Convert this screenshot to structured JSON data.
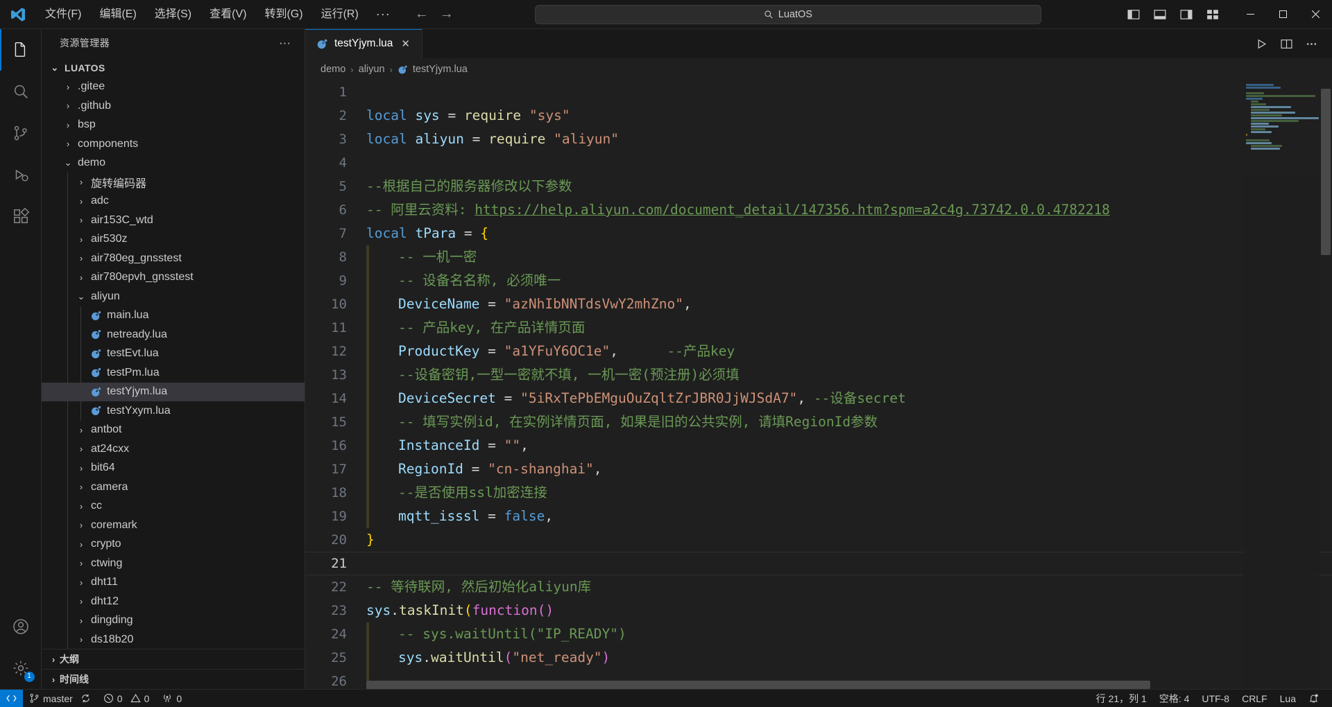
{
  "titlebar": {
    "logo_icon": "vscode-logo",
    "menus": [
      "文件(F)",
      "编辑(E)",
      "选择(S)",
      "查看(V)",
      "转到(G)",
      "运行(R)"
    ],
    "more_label": "···",
    "back_icon": "arrow-left-icon",
    "forward_icon": "arrow-right-icon",
    "search": {
      "value": "LuatOS",
      "icon": "search-icon"
    },
    "layout_icons": [
      "toggle-primary-sidebar-icon",
      "toggle-panel-icon",
      "toggle-secondary-sidebar-icon",
      "customize-layout-icon"
    ],
    "window_buttons": {
      "minimize": "minimize-icon",
      "maximize": "maximize-icon",
      "close": "close-icon"
    }
  },
  "activitybar": {
    "items": [
      {
        "name": "explorer",
        "icon": "files-icon",
        "active": true
      },
      {
        "name": "search",
        "icon": "search-icon",
        "active": false
      },
      {
        "name": "source-control",
        "icon": "source-control-icon",
        "active": false
      },
      {
        "name": "run-and-debug",
        "icon": "debug-icon",
        "active": false
      },
      {
        "name": "extensions",
        "icon": "extensions-icon",
        "active": false
      }
    ],
    "bottom": [
      {
        "name": "accounts",
        "icon": "account-icon",
        "badge": ""
      },
      {
        "name": "settings",
        "icon": "gear-icon",
        "badge": "1"
      }
    ]
  },
  "sidebar": {
    "title": "资源管理器",
    "more_label": "···",
    "root": {
      "label": "LUATOS",
      "expanded": true
    },
    "tree": [
      {
        "label": ".gitee",
        "type": "folder",
        "depth": 1,
        "expanded": false
      },
      {
        "label": ".github",
        "type": "folder",
        "depth": 1,
        "expanded": false
      },
      {
        "label": "bsp",
        "type": "folder",
        "depth": 1,
        "expanded": false
      },
      {
        "label": "components",
        "type": "folder",
        "depth": 1,
        "expanded": false
      },
      {
        "label": "demo",
        "type": "folder",
        "depth": 1,
        "expanded": true
      },
      {
        "label": "旋转编码器",
        "type": "folder",
        "depth": 2,
        "expanded": false
      },
      {
        "label": "adc",
        "type": "folder",
        "depth": 2,
        "expanded": false
      },
      {
        "label": "air153C_wtd",
        "type": "folder",
        "depth": 2,
        "expanded": false
      },
      {
        "label": "air530z",
        "type": "folder",
        "depth": 2,
        "expanded": false
      },
      {
        "label": "air780eg_gnsstest",
        "type": "folder",
        "depth": 2,
        "expanded": false
      },
      {
        "label": "air780epvh_gnsstest",
        "type": "folder",
        "depth": 2,
        "expanded": false
      },
      {
        "label": "aliyun",
        "type": "folder",
        "depth": 2,
        "expanded": true
      },
      {
        "label": "main.lua",
        "type": "lua",
        "depth": 3,
        "expanded": false
      },
      {
        "label": "netready.lua",
        "type": "lua",
        "depth": 3,
        "expanded": false
      },
      {
        "label": "testEvt.lua",
        "type": "lua",
        "depth": 3,
        "expanded": false
      },
      {
        "label": "testPm.lua",
        "type": "lua",
        "depth": 3,
        "expanded": false
      },
      {
        "label": "testYjym.lua",
        "type": "lua",
        "depth": 3,
        "expanded": false,
        "selected": true
      },
      {
        "label": "testYxym.lua",
        "type": "lua",
        "depth": 3,
        "expanded": false
      },
      {
        "label": "antbot",
        "type": "folder",
        "depth": 2,
        "expanded": false
      },
      {
        "label": "at24cxx",
        "type": "folder",
        "depth": 2,
        "expanded": false
      },
      {
        "label": "bit64",
        "type": "folder",
        "depth": 2,
        "expanded": false
      },
      {
        "label": "camera",
        "type": "folder",
        "depth": 2,
        "expanded": false
      },
      {
        "label": "cc",
        "type": "folder",
        "depth": 2,
        "expanded": false
      },
      {
        "label": "coremark",
        "type": "folder",
        "depth": 2,
        "expanded": false
      },
      {
        "label": "crypto",
        "type": "folder",
        "depth": 2,
        "expanded": false
      },
      {
        "label": "ctwing",
        "type": "folder",
        "depth": 2,
        "expanded": false
      },
      {
        "label": "dht11",
        "type": "folder",
        "depth": 2,
        "expanded": false
      },
      {
        "label": "dht12",
        "type": "folder",
        "depth": 2,
        "expanded": false
      },
      {
        "label": "dingding",
        "type": "folder",
        "depth": 2,
        "expanded": false
      },
      {
        "label": "ds18b20",
        "type": "folder",
        "depth": 2,
        "expanded": false
      }
    ],
    "sections": [
      {
        "label": "大纲",
        "expanded": false
      },
      {
        "label": "时间线",
        "expanded": false
      }
    ]
  },
  "editor": {
    "tabs": [
      {
        "label": "testYjym.lua",
        "icon": "lua-file-icon",
        "active": true,
        "close_icon": "close-icon"
      }
    ],
    "actions": [
      "run-icon",
      "split-editor-icon",
      "more-actions-icon"
    ],
    "breadcrumb": [
      "demo",
      "aliyun",
      "testYjym.lua"
    ],
    "breadcrumb_sep": "›",
    "breadcrumb_file_icon": "lua-file-icon",
    "lines": [
      {
        "n": 1,
        "tokens": []
      },
      {
        "n": 2,
        "tokens": [
          {
            "t": "local",
            "c": "k-kw"
          },
          {
            "t": " ",
            "c": "k-plain"
          },
          {
            "t": "sys",
            "c": "k-var"
          },
          {
            "t": " ",
            "c": "k-plain"
          },
          {
            "t": "=",
            "c": "k-op"
          },
          {
            "t": " ",
            "c": "k-plain"
          },
          {
            "t": "require",
            "c": "k-fn"
          },
          {
            "t": " ",
            "c": "k-plain"
          },
          {
            "t": "\"sys\"",
            "c": "k-str"
          }
        ]
      },
      {
        "n": 3,
        "tokens": [
          {
            "t": "local",
            "c": "k-kw"
          },
          {
            "t": " ",
            "c": "k-plain"
          },
          {
            "t": "aliyun",
            "c": "k-var"
          },
          {
            "t": " ",
            "c": "k-plain"
          },
          {
            "t": "=",
            "c": "k-op"
          },
          {
            "t": " ",
            "c": "k-plain"
          },
          {
            "t": "require",
            "c": "k-fn"
          },
          {
            "t": " ",
            "c": "k-plain"
          },
          {
            "t": "\"aliyun\"",
            "c": "k-str"
          }
        ]
      },
      {
        "n": 4,
        "tokens": []
      },
      {
        "n": 5,
        "tokens": [
          {
            "t": "--根据自己的服务器修改以下参数",
            "c": "k-cmt"
          }
        ]
      },
      {
        "n": 6,
        "tokens": [
          {
            "t": "-- 阿里云资料: ",
            "c": "k-cmt"
          },
          {
            "t": "https://help.aliyun.com/document_detail/147356.htm?spm=a2c4g.73742.0.0.4782218",
            "c": "k-link"
          }
        ]
      },
      {
        "n": 7,
        "tokens": [
          {
            "t": "local",
            "c": "k-kw"
          },
          {
            "t": " ",
            "c": "k-plain"
          },
          {
            "t": "tPara",
            "c": "k-var"
          },
          {
            "t": " ",
            "c": "k-plain"
          },
          {
            "t": "=",
            "c": "k-op"
          },
          {
            "t": " ",
            "c": "k-plain"
          },
          {
            "t": "{",
            "c": "k-punc"
          }
        ]
      },
      {
        "n": 8,
        "indent": 1,
        "tokens": [
          {
            "t": "-- 一机一密",
            "c": "k-cmt"
          }
        ]
      },
      {
        "n": 9,
        "indent": 1,
        "tokens": [
          {
            "t": "-- 设备名名称, 必须唯一",
            "c": "k-cmt"
          }
        ]
      },
      {
        "n": 10,
        "indent": 1,
        "tokens": [
          {
            "t": "DeviceName",
            "c": "k-prop"
          },
          {
            "t": " ",
            "c": "k-plain"
          },
          {
            "t": "=",
            "c": "k-op"
          },
          {
            "t": " ",
            "c": "k-plain"
          },
          {
            "t": "\"azNhIbNNTdsVwY2mhZno\"",
            "c": "k-str"
          },
          {
            "t": ",",
            "c": "k-plain"
          }
        ]
      },
      {
        "n": 11,
        "indent": 1,
        "tokens": [
          {
            "t": "-- 产品key, 在产品详情页面",
            "c": "k-cmt"
          }
        ]
      },
      {
        "n": 12,
        "indent": 1,
        "tokens": [
          {
            "t": "ProductKey",
            "c": "k-prop"
          },
          {
            "t": " ",
            "c": "k-plain"
          },
          {
            "t": "=",
            "c": "k-op"
          },
          {
            "t": " ",
            "c": "k-plain"
          },
          {
            "t": "\"a1YFuY6OC1e\"",
            "c": "k-str"
          },
          {
            "t": ",",
            "c": "k-plain"
          },
          {
            "t": "      ",
            "c": "k-plain"
          },
          {
            "t": "--产品key",
            "c": "k-cmt"
          }
        ]
      },
      {
        "n": 13,
        "indent": 1,
        "tokens": [
          {
            "t": "--设备密钥,一型一密就不填, 一机一密(预注册)必须填",
            "c": "k-cmt"
          }
        ]
      },
      {
        "n": 14,
        "indent": 1,
        "tokens": [
          {
            "t": "DeviceSecret",
            "c": "k-prop"
          },
          {
            "t": " ",
            "c": "k-plain"
          },
          {
            "t": "=",
            "c": "k-op"
          },
          {
            "t": " ",
            "c": "k-plain"
          },
          {
            "t": "\"5iRxTePbEMguOuZqltZrJBR0JjWJSdA7\"",
            "c": "k-str"
          },
          {
            "t": ",",
            "c": "k-plain"
          },
          {
            "t": " ",
            "c": "k-plain"
          },
          {
            "t": "--设备secret",
            "c": "k-cmt"
          }
        ]
      },
      {
        "n": 15,
        "indent": 1,
        "tokens": [
          {
            "t": "-- 填写实例id, 在实例详情页面, 如果是旧的公共实例, 请填RegionId参数",
            "c": "k-cmt"
          }
        ]
      },
      {
        "n": 16,
        "indent": 1,
        "tokens": [
          {
            "t": "InstanceId",
            "c": "k-prop"
          },
          {
            "t": " ",
            "c": "k-plain"
          },
          {
            "t": "=",
            "c": "k-op"
          },
          {
            "t": " ",
            "c": "k-plain"
          },
          {
            "t": "\"\"",
            "c": "k-str"
          },
          {
            "t": ",",
            "c": "k-plain"
          }
        ]
      },
      {
        "n": 17,
        "indent": 1,
        "tokens": [
          {
            "t": "RegionId",
            "c": "k-prop"
          },
          {
            "t": " ",
            "c": "k-plain"
          },
          {
            "t": "=",
            "c": "k-op"
          },
          {
            "t": " ",
            "c": "k-plain"
          },
          {
            "t": "\"cn-shanghai\"",
            "c": "k-str"
          },
          {
            "t": ",",
            "c": "k-plain"
          }
        ]
      },
      {
        "n": 18,
        "indent": 1,
        "tokens": [
          {
            "t": "--是否使用ssl加密连接",
            "c": "k-cmt"
          }
        ]
      },
      {
        "n": 19,
        "indent": 1,
        "tokens": [
          {
            "t": "mqtt_isssl",
            "c": "k-prop"
          },
          {
            "t": " ",
            "c": "k-plain"
          },
          {
            "t": "=",
            "c": "k-op"
          },
          {
            "t": " ",
            "c": "k-plain"
          },
          {
            "t": "false",
            "c": "k-bool"
          },
          {
            "t": ",",
            "c": "k-plain"
          }
        ]
      },
      {
        "n": 20,
        "tokens": [
          {
            "t": "}",
            "c": "k-punc"
          }
        ]
      },
      {
        "n": 21,
        "tokens": [],
        "current": true
      },
      {
        "n": 22,
        "tokens": [
          {
            "t": "-- 等待联网, 然后初始化aliyun库",
            "c": "k-cmt"
          }
        ]
      },
      {
        "n": 23,
        "tokens": [
          {
            "t": "sys",
            "c": "k-var"
          },
          {
            "t": ".",
            "c": "k-plain"
          },
          {
            "t": "taskInit",
            "c": "k-fn"
          },
          {
            "t": "(",
            "c": "k-punc"
          },
          {
            "t": "function",
            "c": "k-punc2"
          },
          {
            "t": "(",
            "c": "k-punc2"
          },
          {
            "t": ")",
            "c": "k-punc2"
          }
        ]
      },
      {
        "n": 24,
        "indent": 1,
        "tokens": [
          {
            "t": "-- sys.waitUntil(\"IP_READY\")",
            "c": "k-cmt"
          }
        ]
      },
      {
        "n": 25,
        "indent": 1,
        "tokens": [
          {
            "t": "sys",
            "c": "k-var"
          },
          {
            "t": ".",
            "c": "k-plain"
          },
          {
            "t": "waitUntil",
            "c": "k-fn"
          },
          {
            "t": "(",
            "c": "k-punc2"
          },
          {
            "t": "\"net_ready\"",
            "c": "k-str"
          },
          {
            "t": ")",
            "c": "k-punc2"
          }
        ]
      },
      {
        "n": 26,
        "indent": 1,
        "tokens": []
      }
    ]
  },
  "statusbar": {
    "remote_icon": "remote-icon",
    "left": [
      {
        "icon": "source-control-icon",
        "label": "master"
      },
      {
        "icon": "sync-icon",
        "label": ""
      },
      {
        "icon": "error-icon",
        "label": "0",
        "icon2": "warning-icon",
        "label2": "0"
      },
      {
        "icon": "radio-tower-icon",
        "label": "0"
      }
    ],
    "branch": "master",
    "errors": "0",
    "warnings": "0",
    "ports": "0",
    "right": [
      {
        "name": "cursor-position",
        "label": "行 21，列 1"
      },
      {
        "name": "indentation",
        "label": "空格: 4"
      },
      {
        "name": "encoding",
        "label": "UTF-8"
      },
      {
        "name": "eol",
        "label": "CRLF"
      },
      {
        "name": "language-mode",
        "label": "Lua"
      }
    ],
    "bell_icon": "bell-dot-icon"
  },
  "colors": {
    "accent": "#0078d4",
    "bg": "#1f1f1f",
    "chrome": "#181818",
    "selected_row": "#37373d"
  }
}
